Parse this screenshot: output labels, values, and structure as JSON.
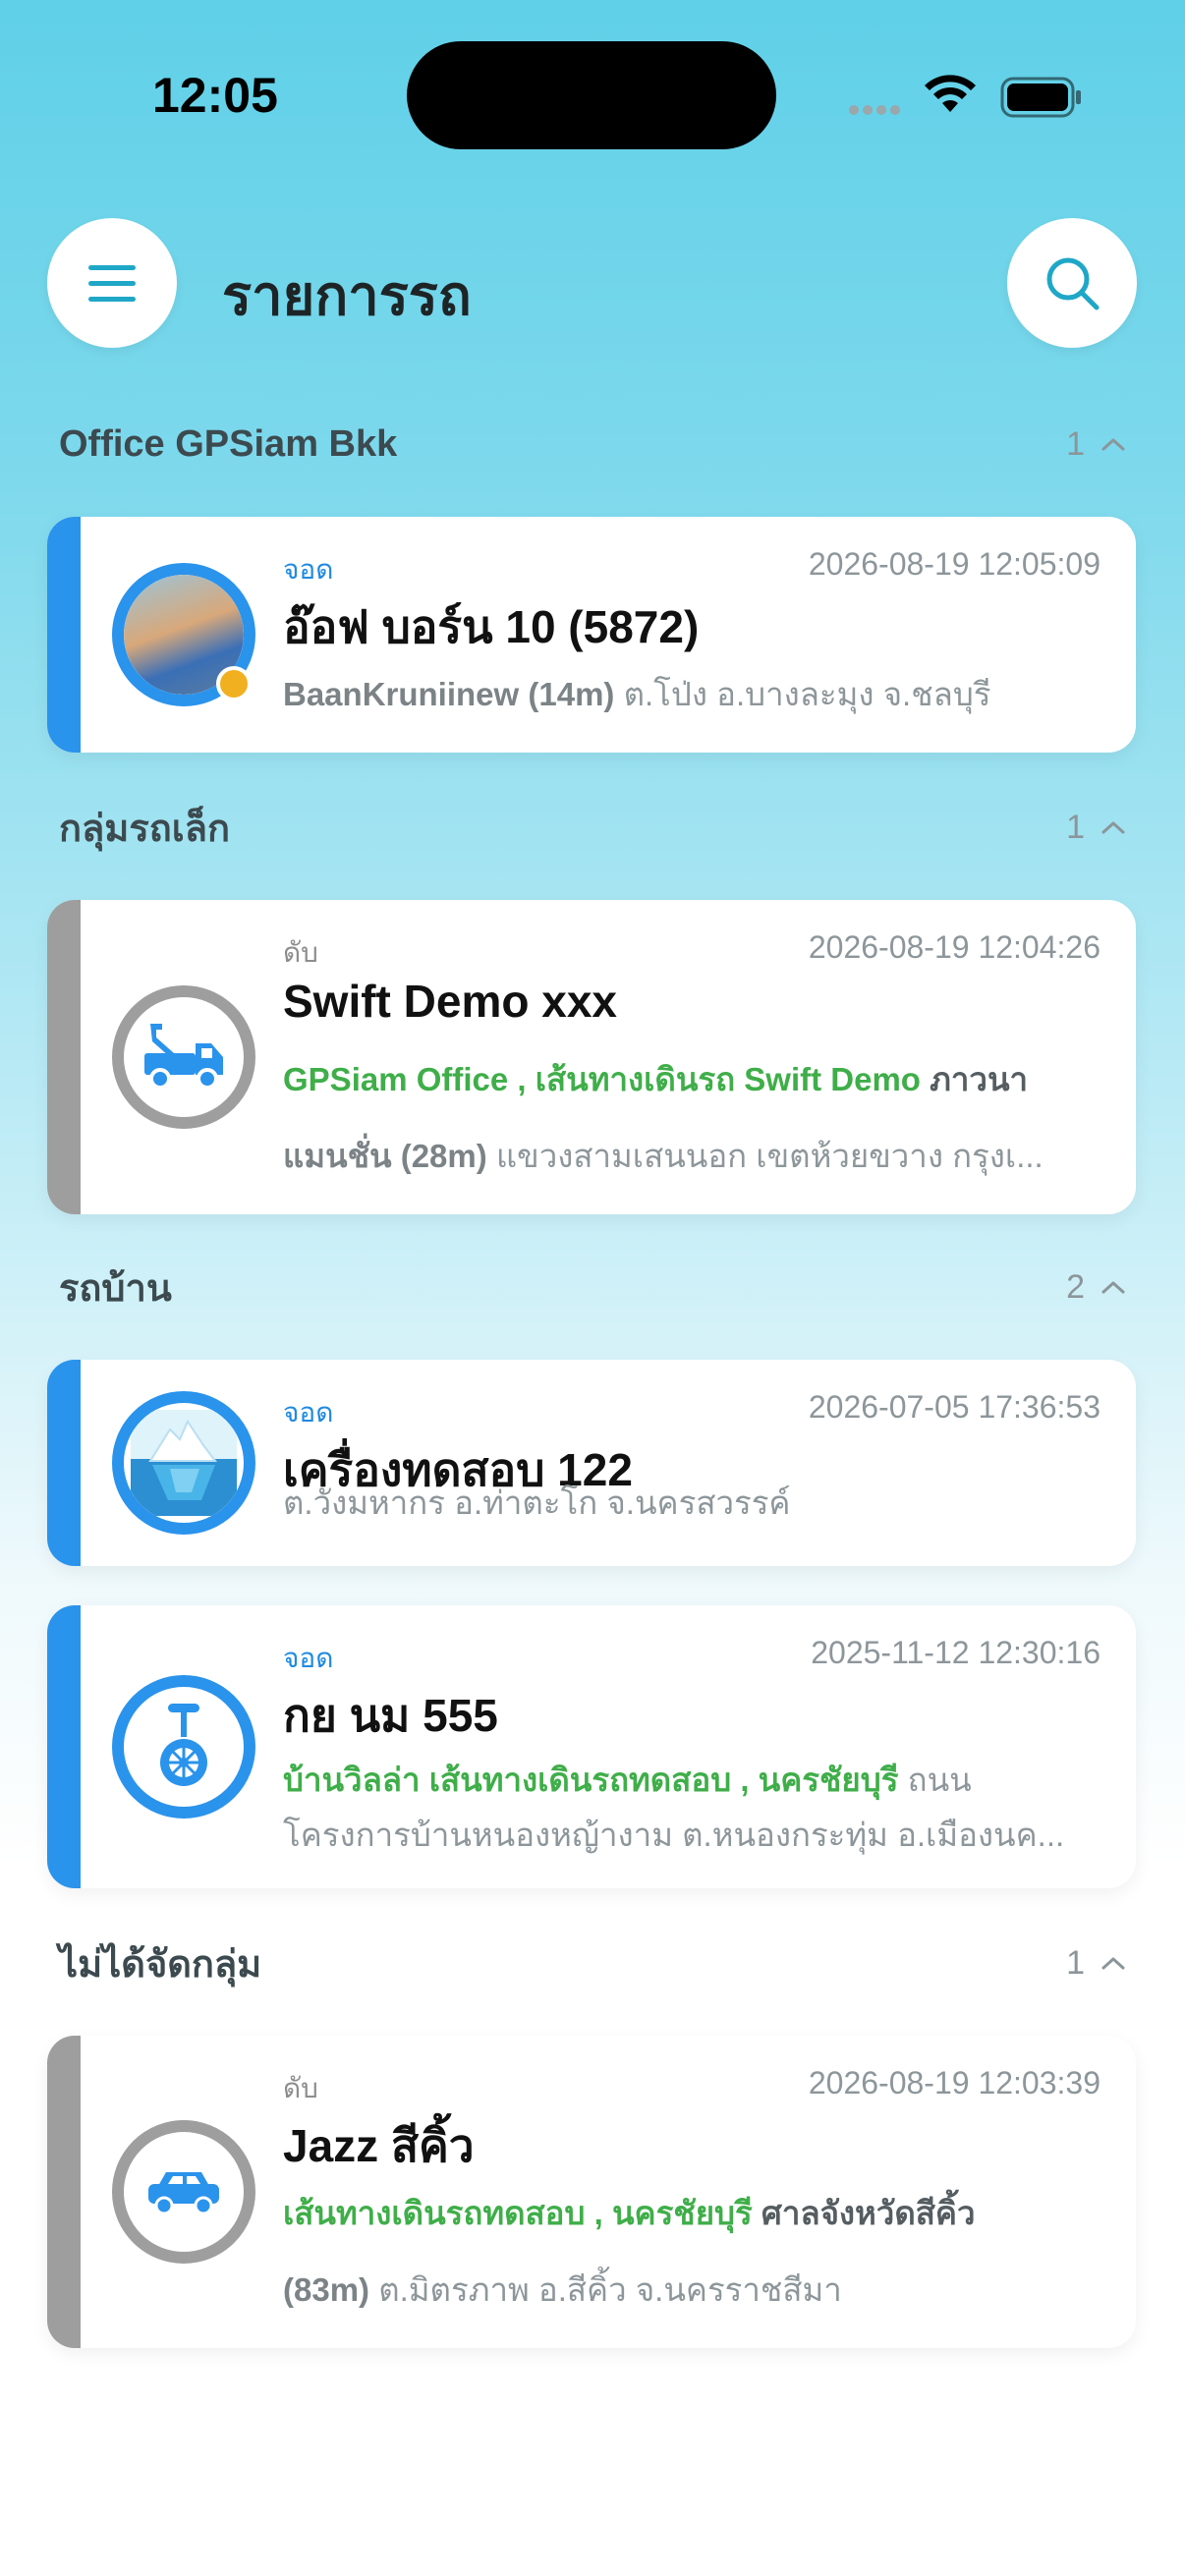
{
  "status_bar": {
    "time": "12:05"
  },
  "header": {
    "title": "รายการรถ"
  },
  "groups": [
    {
      "title": "Office GPSiam Bkk",
      "count": "1",
      "vehicles": [
        {
          "status": "จอด",
          "time": "2026-08-19 12:05:09",
          "name": "อ๊อฟ บอร์น 10 (5872)",
          "place": "BaanKruniinew (14m)",
          "address": "ต.โป่ง อ.บางละมุง จ.ชลบุรี"
        }
      ]
    },
    {
      "title": "กลุ่มรถเล็ก",
      "count": "1",
      "vehicles": [
        {
          "status": "ดับ",
          "time": "2026-08-19 12:04:26",
          "name": "Swift Demo xxx",
          "geofence": "GPSiam Office , เส้นทางเดินรถ Swift Demo",
          "place_part1": "ภาวนา",
          "place_part2": "แมนชั่น (28m)",
          "address": "แขวงสามเสนนอก เขตห้วยขวาง กรุงเ..."
        }
      ]
    },
    {
      "title": "รถบ้าน",
      "count": "2",
      "vehicles": [
        {
          "status": "จอด",
          "time": "2026-07-05 17:36:53",
          "name": "เครื่องทดสอบ 122",
          "address": "ต.วังมหากร อ.ท่าตะโก จ.นครสวรรค์"
        },
        {
          "status": "จอด",
          "time": "2025-11-12 12:30:16",
          "name": "กย นม 555",
          "geofence": "บ้านวิลล่า เส้นทางเดินรถทดสอบ , นครชัยบุรี",
          "place_part1": "ถนน",
          "address": "โครงการบ้านหนองหญ้างาม ต.หนองกระทุ่ม อ.เมืองนค..."
        }
      ]
    },
    {
      "title": "ไม่ได้จัดกลุ่ม",
      "count": "1",
      "vehicles": [
        {
          "status": "ดับ",
          "time": "2026-08-19 12:03:39",
          "name": "Jazz สีคิ้ว",
          "geofence": "เส้นทางเดินรถทดสอบ , นครชัยบุรี",
          "place_part1": "ศาลจังหวัดสีคิ้ว",
          "place_part2": "(83m)",
          "address": "ต.มิตรภาพ อ.สีคิ้ว จ.นครราชสีมา"
        }
      ]
    }
  ],
  "icons": {
    "menu": "menu-icon",
    "search": "search-icon",
    "collapse": "chevron-up-icon",
    "tow_truck": "tow-truck-icon",
    "iceberg": "iceberg-icon",
    "unicycle": "unicycle-icon",
    "car": "car-icon"
  },
  "colors": {
    "parked": "#2a93ec",
    "engine_off": "#9e9e9e",
    "geofence": "#3fae49",
    "accent": "#1fa7c7"
  }
}
